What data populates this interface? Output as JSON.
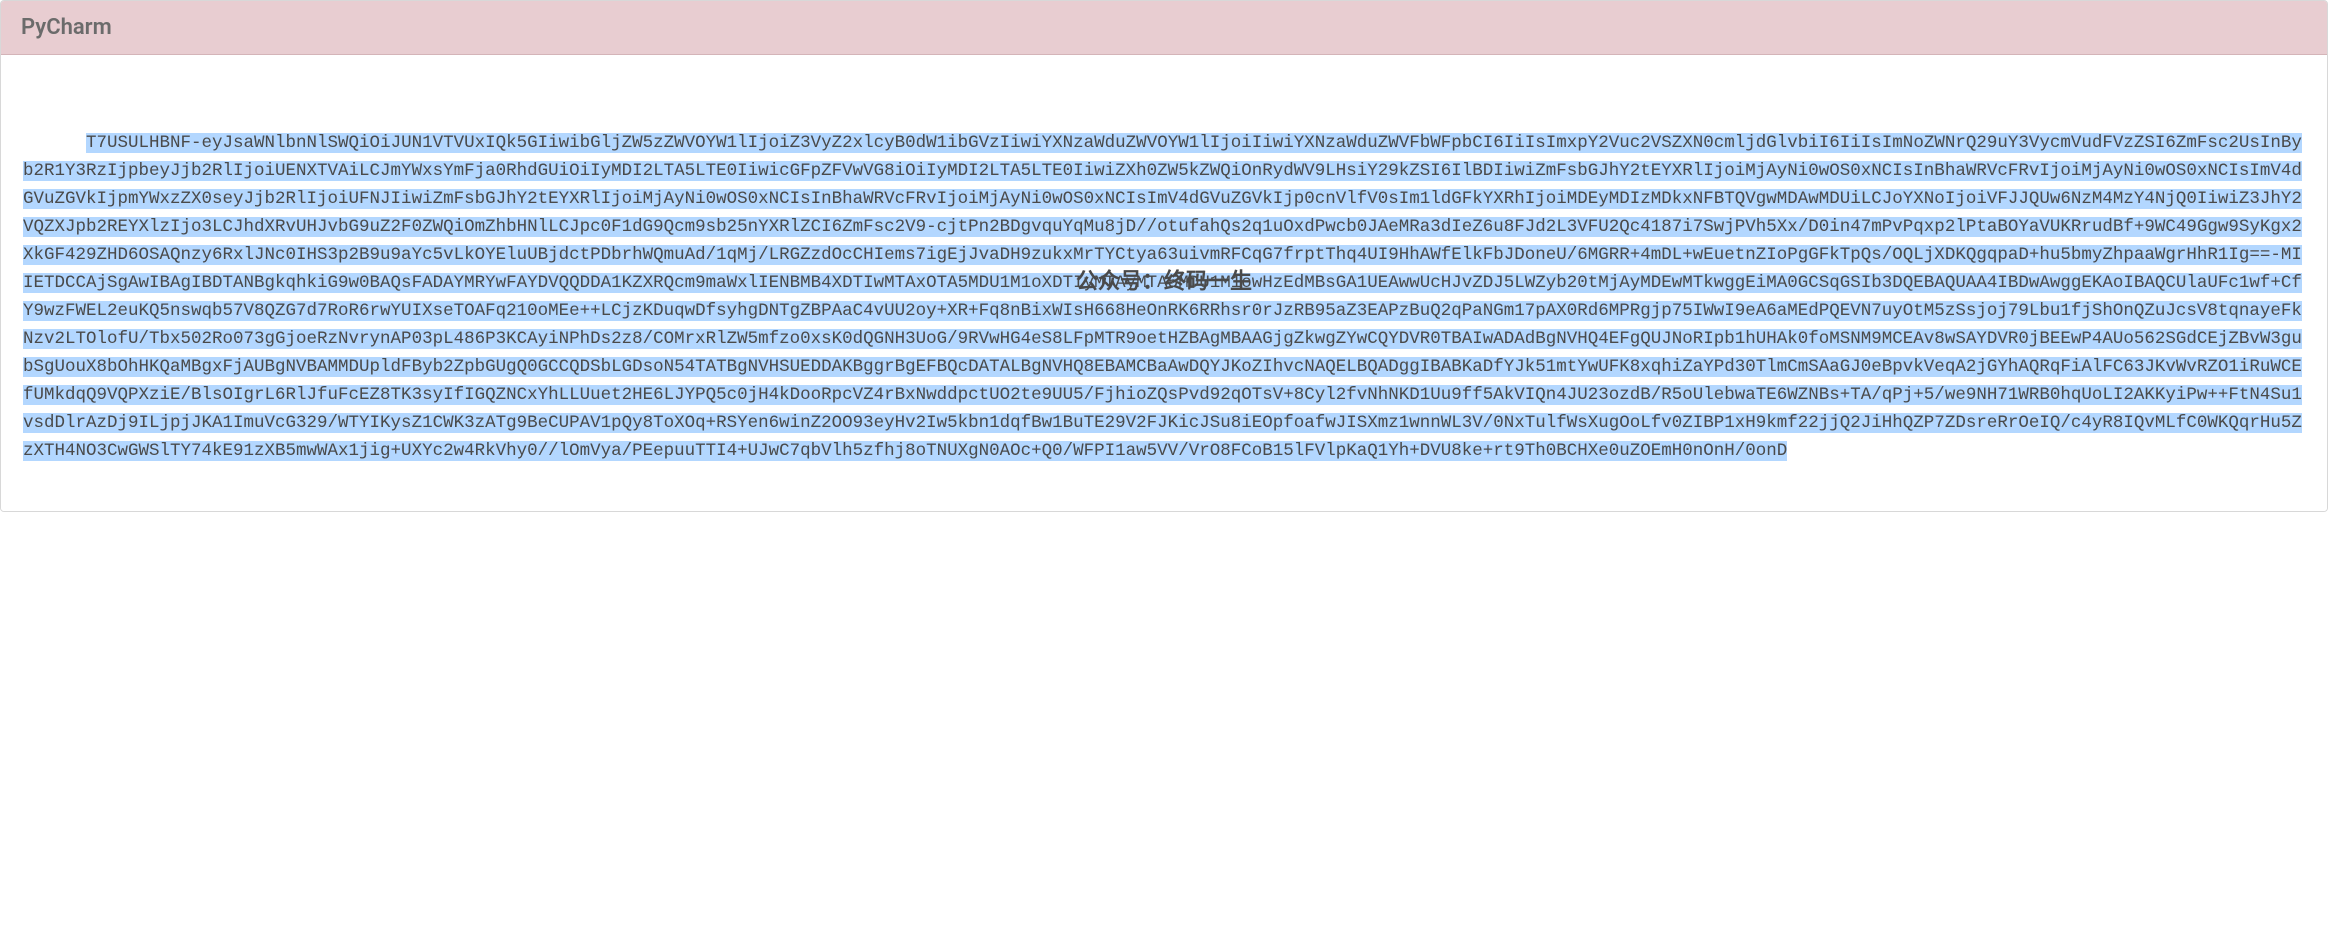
{
  "panel": {
    "title": "PyCharm"
  },
  "watermark": {
    "text": "公众号：终码一生"
  },
  "license": {
    "code": "T7USULHBNF-eyJsaWNlbnNlSWQiOiJUN1VTVUxIQk5GIiwibGljZW5zZWVOYW1lIjoiZ3VyZ2xlcyB0dW1ibGVzIiwiYXNzaWduZWVOYW1lIjoiIiwiYXNzaWduZWVFbWFpbCI6IiIsImxpY2Vuc2VSZXN0cmljdGlvbiI6IiIsImNoZWNrQ29uY3VycmVudFVzZSI6ZmFsc2UsInByb2R1Y3RzIjpbeyJjb2RlIjoiUENXTVAiLCJmYWxsYmFja0RhdGUiOiIyMDI2LTA5LTE0IiwicGFpZFVwVG8iOiIyMDI2LTA5LTE0IiwiZXh0ZW5kZWQiOnRydWV9LHsiY29kZSI6IlBDIiwiZmFsbGJhY2tEYXRlIjoiMjAyNi0wOS0xNCIsInBhaWRVcFRvIjoiMjAyNi0wOS0xNCIsImV4dGVuZGVkIjpmYWxzZX0seyJjb2RlIjoiUFNJIiwiZmFsbGJhY2tEYXRlIjoiMjAyNi0wOS0xNCIsInBhaWRVcFRvIjoiMjAyNi0wOS0xNCIsImV4dGVuZGVkIjp0cnVlfV0sIm1ldGFkYXRhIjoiMDEyMDIzMDkxNFBTQVgwMDAwMDUiLCJoYXNoIjoiVFJJQUw6NzM4MzY4NjQ0IiwiZ3JhY2VQZXJpb2REYXlzIjo3LCJhdXRvUHJvbG9uZ2F0ZWQiOmZhbHNlLCJpc0F1dG9Qcm9sb25nYXRlZCI6ZmFsc2V9-cjtPn2BDgvquYqMu8jD//otufahQs2q1uOxdPwcb0JAeMRa3dIeZ6u8FJd2L3VFU2Qc4187i7SwjPVh5Xx/D0in47mPvPqxp2lPtaBOYaVUKRrudBf+9WC49Ggw9SyKgx2XkGF429ZHD6OSAQnzy6RxlJNc0IHS3p2B9u9aYc5vLkOYEluUBjdctPDbrhWQmuAd/1qMj/LRGZzdOcCHIems7igEjJvaDH9zukxMrTYCtya63uivmRFCqG7frptThq4UI9HhAWfElkFbJDoneU/6MGRR+4mDL+wEuetnZIoPgGFkTpQs/OQLjXDKQgqpaD+hu5bmyZhpaaWgrHhR1Ig==-MIIETDCCAjSgAwIBAgIBDTANBgkqhkiG9w0BAQsFADAYMRYwFAYDVQQDDA1KZXRQcm9maWxlIENBMB4XDTIwMTAxOTA5MDU1M1oXDTIyMTAyMTA5MDU1M1owHzEdMBsGA1UEAwwUcHJvZDJ5LWZyb20tMjAyMDEwMTkwggEiMA0GCSqGSIb3DQEBAQUAA4IBDwAwggEKAoIBAQCUlaUFc1wf+CfY9wzFWEL2euKQ5nswqb57V8QZG7d7RoR6rwYUIXseTOAFq210oMEe++LCjzKDuqwDfsyhgDNTgZBPAaC4vUU2oy+XR+Fq8nBixWIsH668HeOnRK6RRhsr0rJzRB95aZ3EAPzBuQ2qPaNGm17pAX0Rd6MPRgjp75IWwI9eA6aMEdPQEVN7uyOtM5zSsjoj79Lbu1fjShOnQZuJcsV8tqnayeFkNzv2LTOlofU/Tbx502Ro073gGjoeRzNvrynAP03pL486P3KCAyiNPhDs2z8/COMrxRlZW5mfzo0xsK0dQGNH3UoG/9RVwHG4eS8LFpMTR9oetHZBAgMBAAGjgZkwgZYwCQYDVR0TBAIwADAdBgNVHQ4EFgQUJNoRIpb1hUHAk0foMSNM9MCEAv8wSAYDVR0jBEEwP4AUo562SGdCEjZBvW3gubSgUouX8bOhHKQaMBgxFjAUBgNVBAMMDUpldFByb2ZpbGUgQ0GCCQDSbLGDsoN54TATBgNVHSUEDDAKBggrBgEFBQcDATALBgNVHQ8EBAMCBaAwDQYJKoZIhvcNAQELBQADggIBABKaDfYJk51mtYwUFK8xqhiZaYPd30TlmCmSAaGJ0eBpvkVeqA2jGYhAQRqFiAlFC63JKvWvRZO1iRuWCEfUMkdqQ9VQPXziE/BlsOIgrL6RlJfuFcEZ8TK3syIfIGQZNCxYhLLUuet2HE6LJYPQ5c0jH4kDooRpcVZ4rBxNwddpctUO2te9UU5/FjhioZQsPvd92qOTsV+8Cyl2fvNhNKD1Uu9ff5AkVIQn4JU23ozdB/R5oUlebwaTE6WZNBs+TA/qPj+5/we9NH71WRB0hqUoLI2AKKyiPw++FtN4Su1vsdDlrAzDj9ILjpjJKA1ImuVcG329/WTYIKysZ1CWK3zATg9BeCUPAV1pQy8ToXOq+RSYen6winZ2OO93eyHv2Iw5kbn1dqfBw1BuTE29V2FJKicJSu8iEOpfoafwJISXmz1wnnWL3V/0NxTulfWsXugOoLfv0ZIBP1xH9kmf22jjQ2JiHhQZP7ZDsreRrOeIQ/c4yR8IQvMLfC0WKQqrHu5ZzXTH4NO3CwGWSlTY74kE91zXB5mwWAx1jig+UXYc2w4RkVhy0//lOmVya/PEepuuTTI4+UJwC7qbVlh5zfhj8oTNUXgN0AOc+Q0/WFPI1aw5VV/VrO8FCoB15lFVlpKaQ1Yh+DVU8ke+rt9Th0BCHXe0uZOEmH0nOnH/0onD"
  }
}
